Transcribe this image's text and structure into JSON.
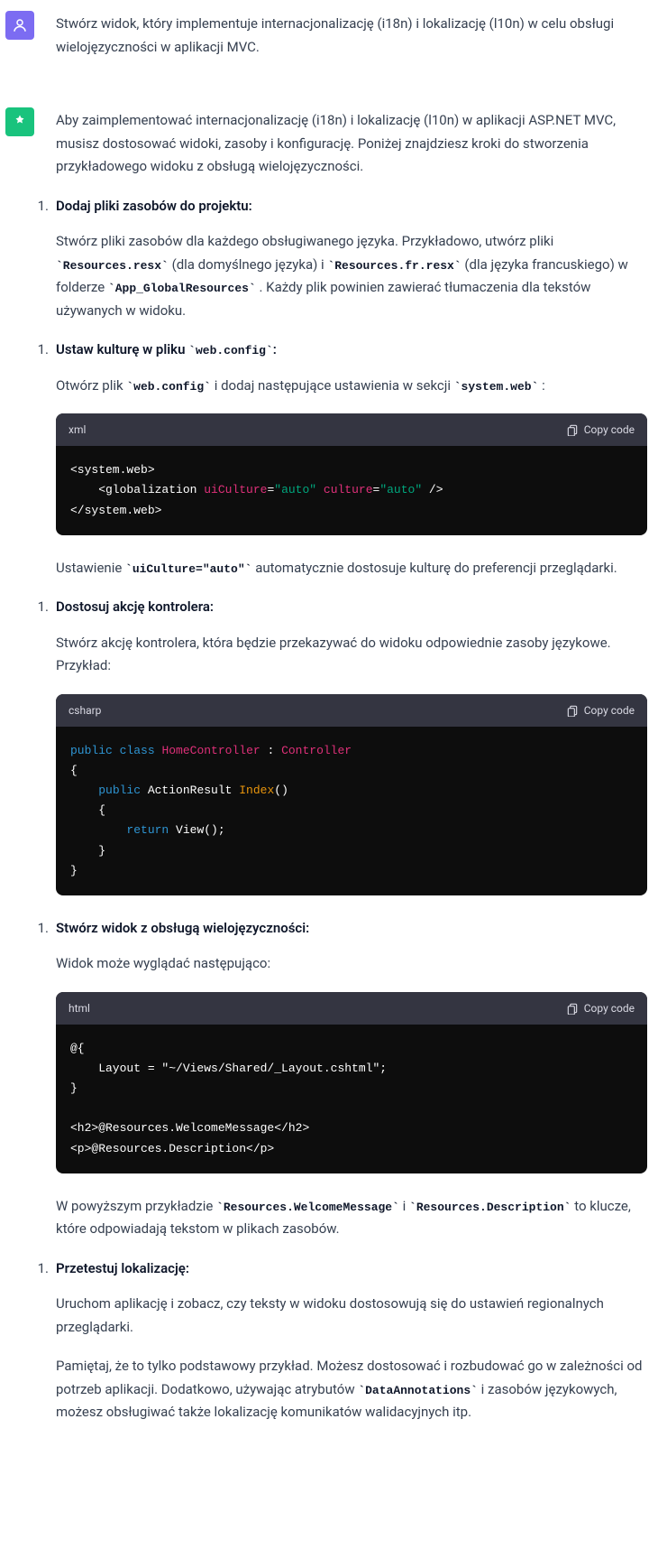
{
  "user": {
    "message": "Stwórz widok, który implementuje internacjonalizację (i18n) i lokalizację (l10n) w celu obsługi wielojęzyczności w aplikacji MVC."
  },
  "assistant": {
    "intro": "Aby zaimplementować internacjonalizację (i18n) i lokalizację (l10n) w aplikacji ASP.NET MVC, musisz dostosować widoki, zasoby i konfigurację. Poniżej znajdziesz kroki do stworzenia przykładowego widoku z obsługą wielojęzyczności.",
    "copy_label": "Copy code",
    "step1": {
      "num": "1.",
      "title": "Dodaj pliki zasobów do projektu:",
      "text_a": "Stwórz pliki zasobów dla każdego obsługiwanego języka. Przykładowo, utwórz pliki ",
      "code_a": "`Resources.resx`",
      "text_b": " (dla domyślnego języka) i ",
      "code_b": "`Resources.fr.resx`",
      "text_c": " (dla języka francuskiego) w folderze ",
      "code_c": "`App_GlobalResources`",
      "text_d": ". Każdy plik powinien zawierać tłumaczenia dla tekstów używanych w widoku."
    },
    "step2": {
      "num": "1.",
      "title_a": "Ustaw kulturę w pliku ",
      "title_code": "`web.config`",
      "title_b": ":",
      "text_a": "Otwórz plik ",
      "code_a": "`web.config`",
      "text_b": " i dodaj następujące ustawienia w sekcji ",
      "code_b": "`system.web`",
      "text_c": ":",
      "lang": "xml",
      "code": {
        "l1a": "<system.web>",
        "l2a": "    <globalization ",
        "l2b": "uiCulture",
        "l2c": "=",
        "l2d": "\"auto\"",
        "l2e": " ",
        "l2f": "culture",
        "l2g": "=",
        "l2h": "\"auto\"",
        "l2i": " />",
        "l3a": "</system.web>"
      },
      "after_a": "Ustawienie ",
      "after_code": "`uiCulture=\"auto\"`",
      "after_b": " automatycznie dostosuje kulturę do preferencji przeglądarki."
    },
    "step3": {
      "num": "1.",
      "title": "Dostosuj akcję kontrolera:",
      "text": "Stwórz akcję kontrolera, która będzie przekazywać do widoku odpowiednie zasoby językowe. Przykład:",
      "lang": "csharp",
      "code": {
        "l1a": "public",
        "l1b": " ",
        "l1c": "class",
        "l1d": " ",
        "l1e": "HomeController",
        "l1f": " : ",
        "l1g": "Controller",
        "l2": "{",
        "l3a": "    ",
        "l3b": "public",
        "l3c": " ActionResult ",
        "l3d": "Index",
        "l3e": "()",
        "l4": "    {",
        "l5a": "        ",
        "l5b": "return",
        "l5c": " View();",
        "l6": "    }",
        "l7": "}"
      }
    },
    "step4": {
      "num": "1.",
      "title": "Stwórz widok z obsługą wielojęzyczności:",
      "text": "Widok może wyglądać następująco:",
      "lang": "html",
      "code": {
        "l1": "@{",
        "l2": "    Layout = \"~/Views/Shared/_Layout.cshtml\";",
        "l3": "}",
        "l4": "",
        "l5": "<h2>@Resources.WelcomeMessage</h2>",
        "l6": "<p>@Resources.Description</p>"
      },
      "after_a": "W powyższym przykładzie ",
      "after_code_a": "`Resources.WelcomeMessage`",
      "after_b": " i ",
      "after_code_b": "`Resources.Description`",
      "after_c": " to klucze, które odpowiadają tekstom w plikach zasobów."
    },
    "step5": {
      "num": "1.",
      "title": "Przetestuj lokalizację:",
      "text": "Uruchom aplikację i zobacz, czy teksty w widoku dostosowują się do ustawień regionalnych przeglądarki."
    },
    "outro_a": "Pamiętaj, że to tylko podstawowy przykład. Możesz dostosować i rozbudować go w zależności od potrzeb aplikacji. Dodatkowo, używając atrybutów ",
    "outro_code": "`DataAnnotations`",
    "outro_b": " i zasobów językowych, możesz obsługiwać także lokalizację komunikatów walidacyjnych itp."
  }
}
